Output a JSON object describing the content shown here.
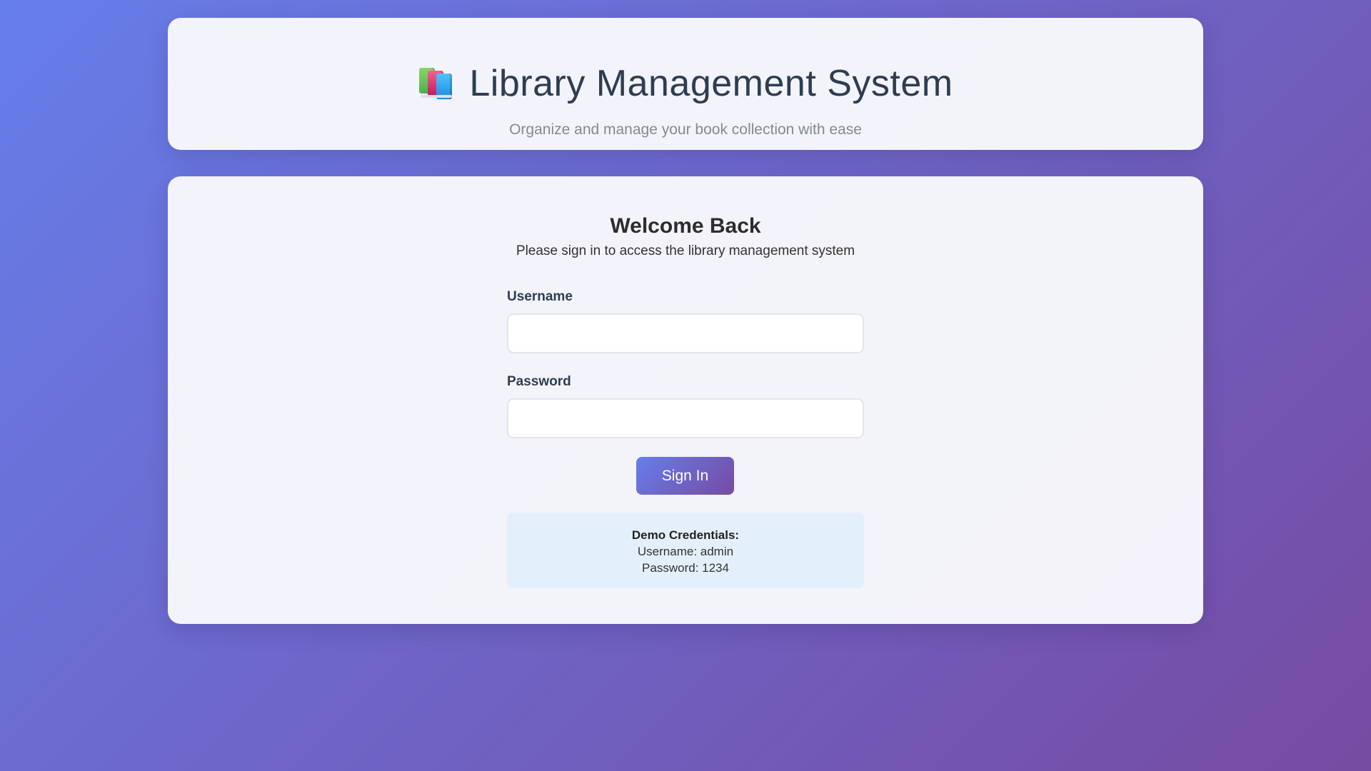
{
  "header": {
    "title": "Library Management System",
    "subtitle": "Organize and manage your book collection with ease",
    "icon": "books-icon"
  },
  "login": {
    "welcome_title": "Welcome Back",
    "welcome_subtitle": "Please sign in to access the library management system",
    "username_label": "Username",
    "username_value": "",
    "password_label": "Password",
    "password_value": "",
    "signin_label": "Sign In"
  },
  "demo": {
    "heading": "Demo Credentials:",
    "username_line": "Username: admin",
    "password_line": "Password: 1234"
  },
  "colors": {
    "background_start": "#667eea",
    "background_end": "#764ba2",
    "demo_box": "#e3f0fb"
  }
}
